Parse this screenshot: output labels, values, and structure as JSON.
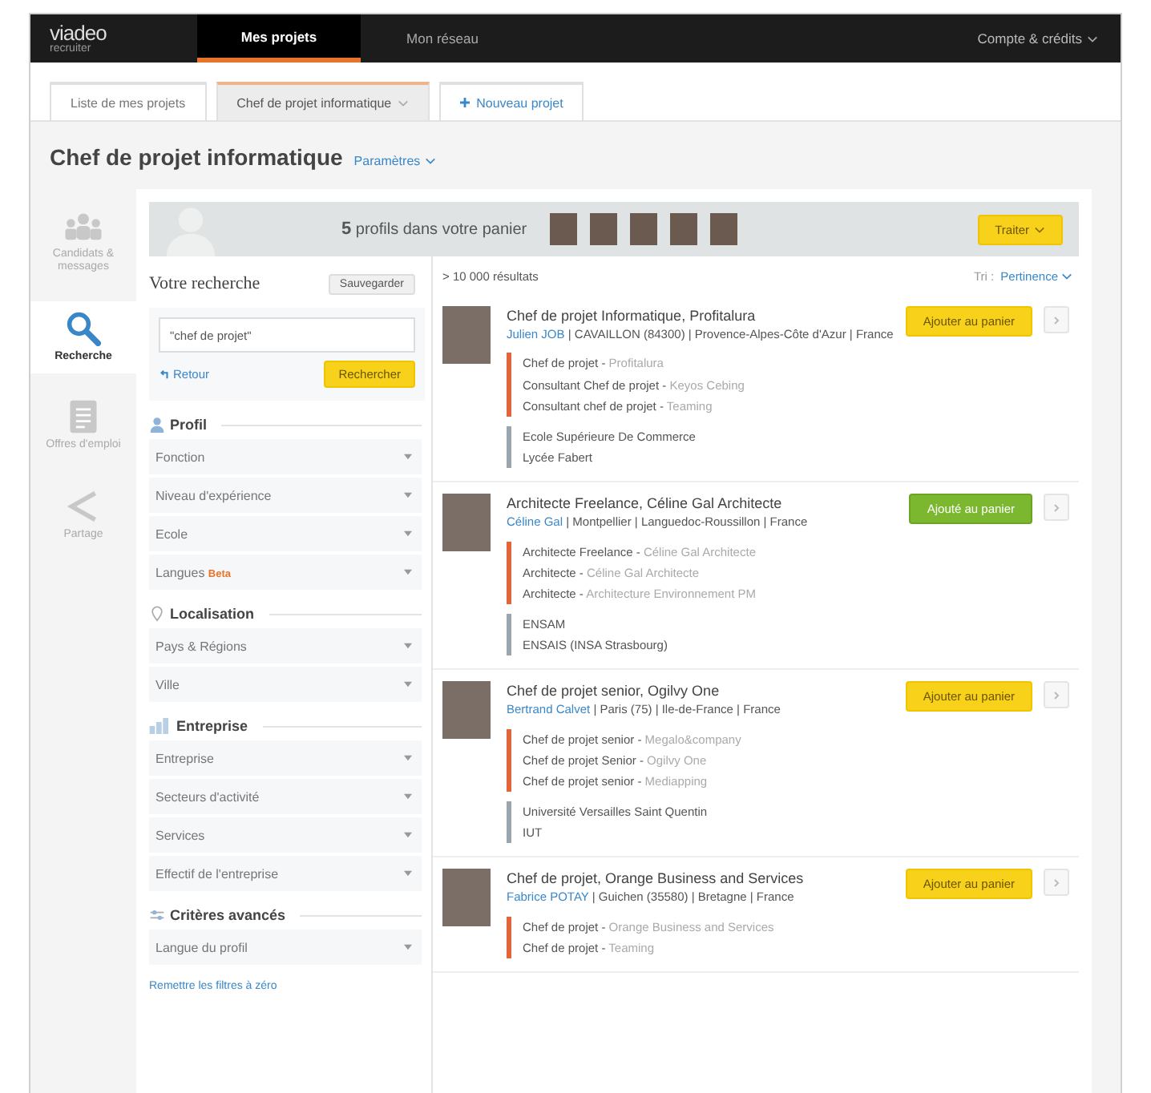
{
  "topbar": {
    "logo": "viadeo",
    "logo_sub": "recruiter",
    "nav": [
      {
        "label": "Mes projets",
        "selected": true
      },
      {
        "label": "Mon réseau",
        "selected": false
      }
    ],
    "account": "Compte & crédits"
  },
  "tabs": [
    {
      "label": "Liste de mes projets",
      "selected": false,
      "kind": "plain"
    },
    {
      "label": "Chef de projet informatique",
      "selected": true,
      "kind": "closable"
    },
    {
      "label": "Nouveau projet",
      "selected": false,
      "kind": "add"
    }
  ],
  "page_title": "Chef de projet informatique",
  "params_link": "Paramètres",
  "side_nav": [
    {
      "label": "Candidats & messages",
      "selected": false,
      "kind": "people"
    },
    {
      "label": "Recherche",
      "selected": true,
      "kind": "search"
    },
    {
      "label": "Offres d'emploi",
      "selected": false,
      "kind": "document"
    },
    {
      "label": "Partage",
      "selected": false,
      "kind": "share"
    }
  ],
  "basket": {
    "count": "5",
    "text": "profils dans votre panier",
    "action": "Traiter"
  },
  "search": {
    "title": "Votre recherche",
    "save": "Sauvegarder",
    "query": "\"chef de projet\"",
    "back": "Retour",
    "submit": "Rechercher"
  },
  "filter_sections": [
    {
      "title": "Profil",
      "kind": "person",
      "fields": [
        {
          "label": "Fonction"
        },
        {
          "label": "Niveau d'expérience"
        },
        {
          "label": "Ecole"
        },
        {
          "label": "Langues",
          "badge": "Beta"
        }
      ]
    },
    {
      "title": "Localisation",
      "kind": "pin",
      "fields": [
        {
          "label": "Pays & Régions"
        },
        {
          "label": "Ville"
        }
      ]
    },
    {
      "title": "Entreprise",
      "kind": "bars",
      "fields": [
        {
          "label": "Entreprise"
        },
        {
          "label": "Secteurs d'activité"
        },
        {
          "label": "Services"
        },
        {
          "label": "Effectif de l'entreprise"
        }
      ]
    },
    {
      "title": "Critères avancés",
      "kind": "sliders",
      "fields": [
        {
          "label": "Langue du profil"
        }
      ]
    }
  ],
  "reset_link": "Remettre les filtres à zéro",
  "results": {
    "count": "> 10 000 résultats",
    "sort_label": "Tri :",
    "sort_value": "Pertinence"
  },
  "candidates": [
    {
      "headline": "Chef de projet Informatique, Profitalura",
      "name": "Julien JOB",
      "location": "| CAVAILLON (84300) | Provence-Alpes-Côte d'Azur | France",
      "button": "Ajouter au panier",
      "in_basket": false,
      "experiences": [
        {
          "title": "Chef de projet -",
          "company": "Profitalura"
        },
        {
          "title": "Consultant Chef de projet -",
          "company": "Keyos Cebing"
        },
        {
          "title": "Consultant chef de projet -",
          "company": "Teaming"
        }
      ],
      "education": [
        "Ecole Supérieure De Commerce",
        "Lycée Fabert"
      ]
    },
    {
      "headline": "Architecte Freelance, Céline Gal Architecte",
      "name": "Céline Gal",
      "location": "| Montpellier | Languedoc-Roussillon | France",
      "button": "Ajouté au panier",
      "in_basket": true,
      "experiences": [
        {
          "title": "Architecte Freelance -",
          "company": "Céline Gal Architecte"
        },
        {
          "title": "Architecte -",
          "company": "Céline Gal Architecte"
        },
        {
          "title": "Architecte -",
          "company": "Architecture Environnement PM"
        }
      ],
      "education": [
        "ENSAM",
        "ENSAIS (INSA Strasbourg)"
      ]
    },
    {
      "headline": "Chef de projet senior, Ogilvy One",
      "name": "Bertrand Calvet",
      "location": "| Paris (75) | Ile-de-France | France",
      "button": "Ajouter au panier",
      "in_basket": false,
      "experiences": [
        {
          "title": "Chef de projet senior -",
          "company": "Megalo&company"
        },
        {
          "title": "Chef de projet Senior -",
          "company": "Ogilvy One"
        },
        {
          "title": "Chef de projet senior -",
          "company": "Mediapping"
        }
      ],
      "education": [
        "Université Versailles Saint Quentin",
        "IUT"
      ]
    },
    {
      "headline": "Chef de projet, Orange Business and Services",
      "name": "Fabrice POTAY",
      "location": "| Guichen (35580) | Bretagne | France",
      "button": "Ajouter au panier",
      "in_basket": false,
      "experiences": [
        {
          "title": "Chef de projet -",
          "company": "Orange Business and Services"
        },
        {
          "title": "Chef de projet -",
          "company": "Teaming"
        }
      ]
    }
  ]
}
